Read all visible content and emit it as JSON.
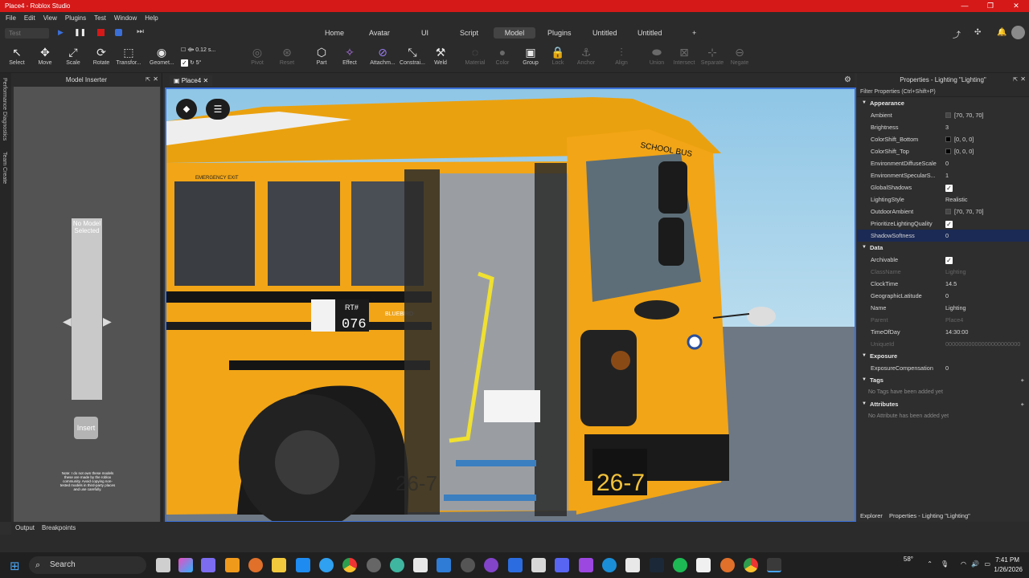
{
  "window": {
    "title": "Place4 - Roblox Studio",
    "controls": [
      "—",
      "❐",
      "✕"
    ]
  },
  "menu": [
    "File",
    "Edit",
    "View",
    "Plugins",
    "Test",
    "Window",
    "Help"
  ],
  "playbar": {
    "mode": "Test"
  },
  "tabs": [
    "Home",
    "Avatar",
    "UI",
    "Script",
    "Model",
    "Plugins",
    "Untitled",
    "Untitled",
    "+"
  ],
  "active_tab": "Model",
  "toolbar": {
    "select": "Select",
    "move": "Move",
    "scale": "Scale",
    "rotate": "Rotate",
    "transform": "Transfor...",
    "geometry": "Geomet...",
    "move_inc": "0.12 s...",
    "rot_inc": "5°",
    "pivot": "Pivot",
    "reset": "Reset",
    "part": "Part",
    "effect": "Effect",
    "attachment": "Attachm...",
    "constraint": "Constrai...",
    "weld": "Weld",
    "material": "Material",
    "color": "Color",
    "group": "Group",
    "lock": "Lock",
    "anchor": "Anchor",
    "align": "Align",
    "union": "Union",
    "intersect": "Intersect",
    "separate": "Separate",
    "negate": "Negate"
  },
  "left_strip": {
    "perf": "Performance Diagnostics",
    "team": "Team Create"
  },
  "model_inserter": {
    "title": "Model Inserter",
    "preview": "No Model Selected",
    "insert": "Insert",
    "note": "Note: I do not own these models these are made by the roblox community. Avoid copying non-tested models in third-party places and use carefully."
  },
  "doc_tab": "Place4",
  "scene": {
    "exit": "EMERGENCY EXIT",
    "rt": "RT#",
    "rt_num": "076",
    "brand": "BLUEBIRD",
    "plate": "26-7",
    "side": "26-7",
    "roof": "SCHOOL BUS"
  },
  "properties": {
    "title": "Properties - Lighting \"Lighting\"",
    "filter": "Filter Properties (Ctrl+Shift+P)",
    "appearance": {
      "label": "Appearance",
      "rows": [
        {
          "name": "Ambient",
          "value": "[70, 70, 70]",
          "swatch": "#464646"
        },
        {
          "name": "Brightness",
          "value": "3"
        },
        {
          "name": "ColorShift_Bottom",
          "value": "[0, 0, 0]",
          "swatch": "#000000"
        },
        {
          "name": "ColorShift_Top",
          "value": "[0, 0, 0]",
          "swatch": "#000000"
        },
        {
          "name": "EnvironmentDiffuseScale",
          "value": "0"
        },
        {
          "name": "EnvironmentSpecularS...",
          "value": "1"
        },
        {
          "name": "GlobalShadows",
          "value": "✓",
          "check": true
        },
        {
          "name": "LightingStyle",
          "value": "Realistic"
        },
        {
          "name": "OutdoorAmbient",
          "value": "[70, 70, 70]",
          "swatch": "#464646"
        },
        {
          "name": "PrioritizeLightingQuality",
          "value": "✓",
          "check": true
        },
        {
          "name": "ShadowSoftness",
          "value": "0",
          "selected": true
        }
      ]
    },
    "data": {
      "label": "Data",
      "rows": [
        {
          "name": "Archivable",
          "value": "✓",
          "check": true
        },
        {
          "name": "ClassName",
          "value": "Lighting",
          "readonly": true
        },
        {
          "name": "ClockTime",
          "value": "14.5"
        },
        {
          "name": "GeographicLatitude",
          "value": "0"
        },
        {
          "name": "Name",
          "value": "Lighting"
        },
        {
          "name": "Parent",
          "value": "Place4",
          "readonly": true
        },
        {
          "name": "TimeOfDay",
          "value": "14:30:00"
        },
        {
          "name": "UniqueId",
          "value": "00000000000000000000000",
          "readonly": true
        }
      ]
    },
    "exposure": {
      "label": "Exposure",
      "rows": [
        {
          "name": "ExposureCompensation",
          "value": "0"
        }
      ]
    },
    "tags": {
      "label": "Tags",
      "empty": "No Tags have been added yet"
    },
    "attributes": {
      "label": "Attributes",
      "empty": "No Attribute has been added yet"
    }
  },
  "bottom_tabs": [
    "Explorer",
    "Properties - Lighting \"Lighting\""
  ],
  "output_tabs": [
    "Output",
    "Breakpoints"
  ],
  "taskbar": {
    "search": "Search",
    "weather": "58°",
    "time": "7:41 PM",
    "date": "1/26/2026"
  },
  "colors": {
    "accent": "#3a6fd8",
    "titlebar": "#d51919",
    "bus": "#f2a516"
  }
}
